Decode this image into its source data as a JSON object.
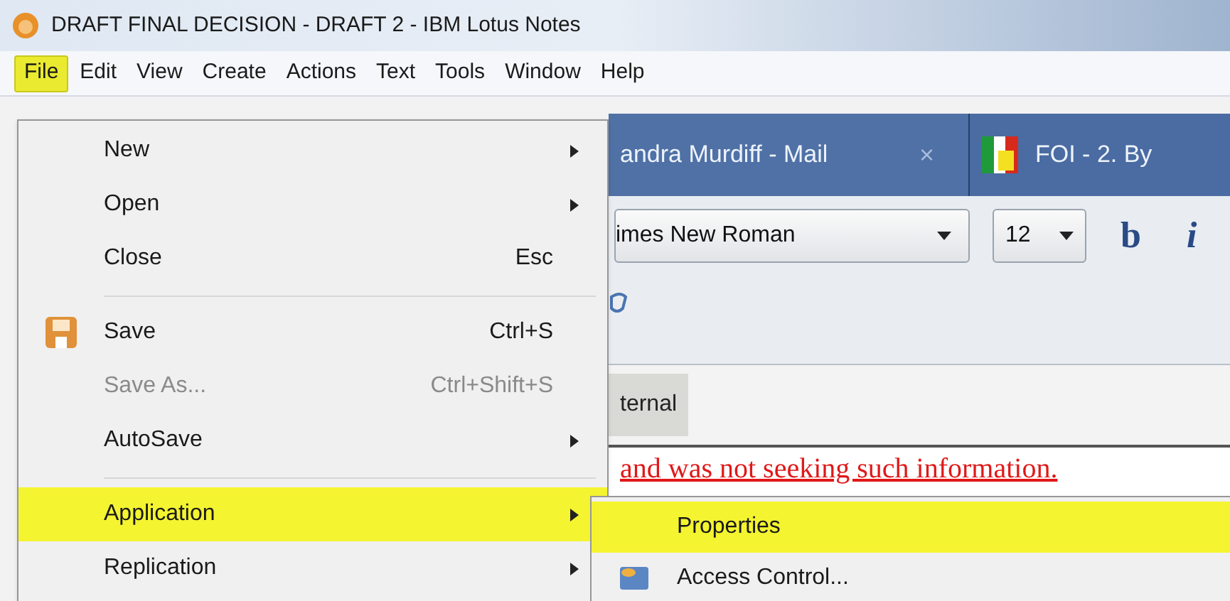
{
  "window": {
    "title": "DRAFT FINAL DECISION - DRAFT 2 - IBM Lotus Notes"
  },
  "menu_bar": [
    {
      "label": "File",
      "selected": true
    },
    {
      "label": "Edit",
      "selected": false
    },
    {
      "label": "View",
      "selected": false
    },
    {
      "label": "Create",
      "selected": false
    },
    {
      "label": "Actions",
      "selected": false
    },
    {
      "label": "Text",
      "selected": false
    },
    {
      "label": "Tools",
      "selected": false
    },
    {
      "label": "Window",
      "selected": false
    },
    {
      "label": "Help",
      "selected": false
    }
  ],
  "tabs": [
    {
      "label": "andra Murdiff - Mail",
      "close": "×"
    },
    {
      "label": "FOI - 2. By"
    }
  ],
  "toolbar": {
    "font": "imes New Roman",
    "size": "12",
    "bold": "b",
    "italic": "i"
  },
  "section_tab": "ternal",
  "body_text": "and was not seeking such information.",
  "file_menu": [
    {
      "kind": "item",
      "label": "New",
      "submenu": true,
      "disabled": false,
      "selected": false
    },
    {
      "kind": "item",
      "label": "Open",
      "submenu": true,
      "disabled": false,
      "selected": false
    },
    {
      "kind": "item",
      "label": "Close",
      "shortcut": "Esc",
      "disabled": false,
      "selected": false
    },
    {
      "kind": "separator"
    },
    {
      "kind": "item",
      "label": "Save",
      "shortcut": "Ctrl+S",
      "icon": true,
      "disabled": false,
      "selected": false
    },
    {
      "kind": "item",
      "label": "Save As...",
      "shortcut": "Ctrl+Shift+S",
      "disabled": true,
      "selected": false
    },
    {
      "kind": "item",
      "label": "AutoSave",
      "submenu": true,
      "disabled": false,
      "selected": false
    },
    {
      "kind": "separator"
    },
    {
      "kind": "item",
      "label": "Application",
      "submenu": true,
      "disabled": false,
      "selected": true
    },
    {
      "kind": "item",
      "label": "Replication",
      "submenu": true,
      "disabled": false,
      "selected": false
    }
  ],
  "application_submenu": [
    {
      "label": "Properties",
      "selected": true
    },
    {
      "label": "Access Control...",
      "icon": true,
      "selected": false
    }
  ]
}
